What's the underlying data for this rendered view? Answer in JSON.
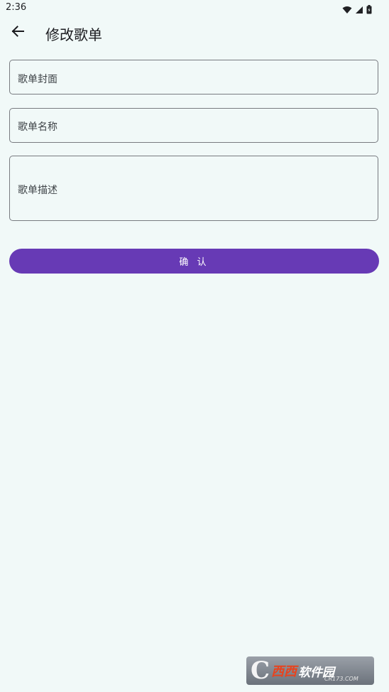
{
  "status_bar": {
    "time": "2:36",
    "icons": [
      "wifi-icon",
      "signal-icon",
      "battery-icon"
    ]
  },
  "app_bar": {
    "back_icon": "arrow-left-icon",
    "title": "修改歌单"
  },
  "form": {
    "cover_label": "歌单封面",
    "name_label": "歌单名称",
    "description_label": "歌单描述",
    "confirm_label": "确 认"
  },
  "watermark": {
    "text_red": "西西",
    "text_white": "软件园",
    "subtext": "CR173.COM"
  },
  "colors": {
    "background": "#f1f9f8",
    "primary": "#673ab5",
    "outline": "#787b80"
  }
}
